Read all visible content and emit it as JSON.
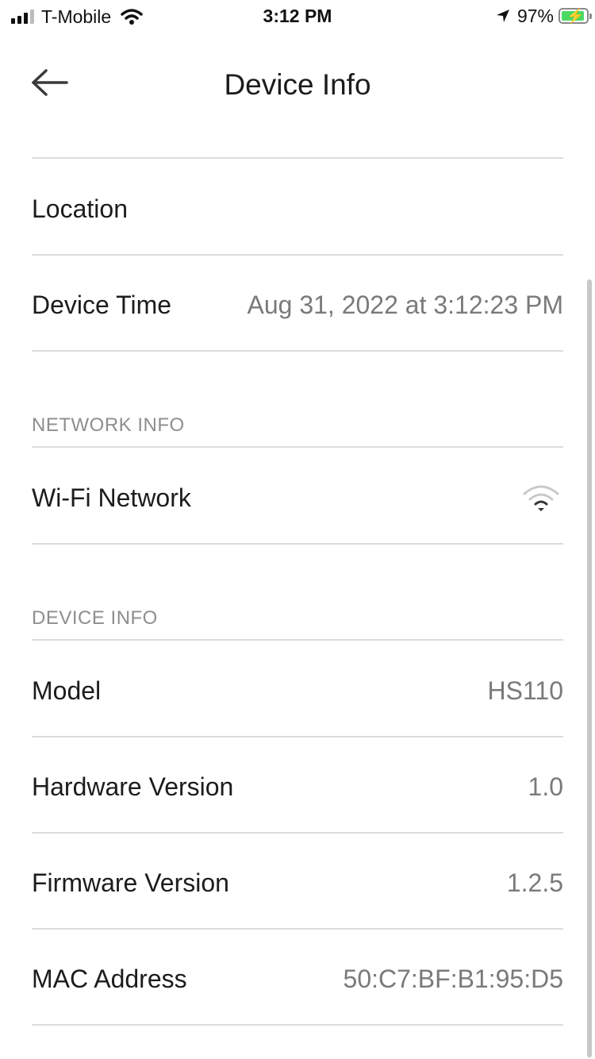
{
  "status_bar": {
    "carrier": "T-Mobile",
    "time": "3:12 PM",
    "battery_percent": "97%",
    "icons": [
      "signal-icon",
      "wifi-icon",
      "location-arrow-icon",
      "battery-charging-icon"
    ]
  },
  "header": {
    "title": "Device Info",
    "back_icon": "back-arrow-icon"
  },
  "general": {
    "location_label": "Location",
    "device_time_label": "Device Time",
    "device_time_value": "Aug 31, 2022 at 3:12:23 PM"
  },
  "network_info": {
    "header": "NETWORK INFO",
    "wifi_label": "Wi-Fi Network",
    "wifi_icon": "wifi-signal-icon"
  },
  "device_info": {
    "header": "DEVICE INFO",
    "rows": [
      {
        "label": "Model",
        "value": "HS110"
      },
      {
        "label": "Hardware Version",
        "value": "1.0"
      },
      {
        "label": "Firmware Version",
        "value": "1.2.5"
      },
      {
        "label": "MAC Address",
        "value": "50:C7:BF:B1:95:D5"
      }
    ]
  },
  "colors": {
    "accent_battery": "#4cd964",
    "divider": "#dcdcdc",
    "secondary_text": "#7a7a7a"
  }
}
